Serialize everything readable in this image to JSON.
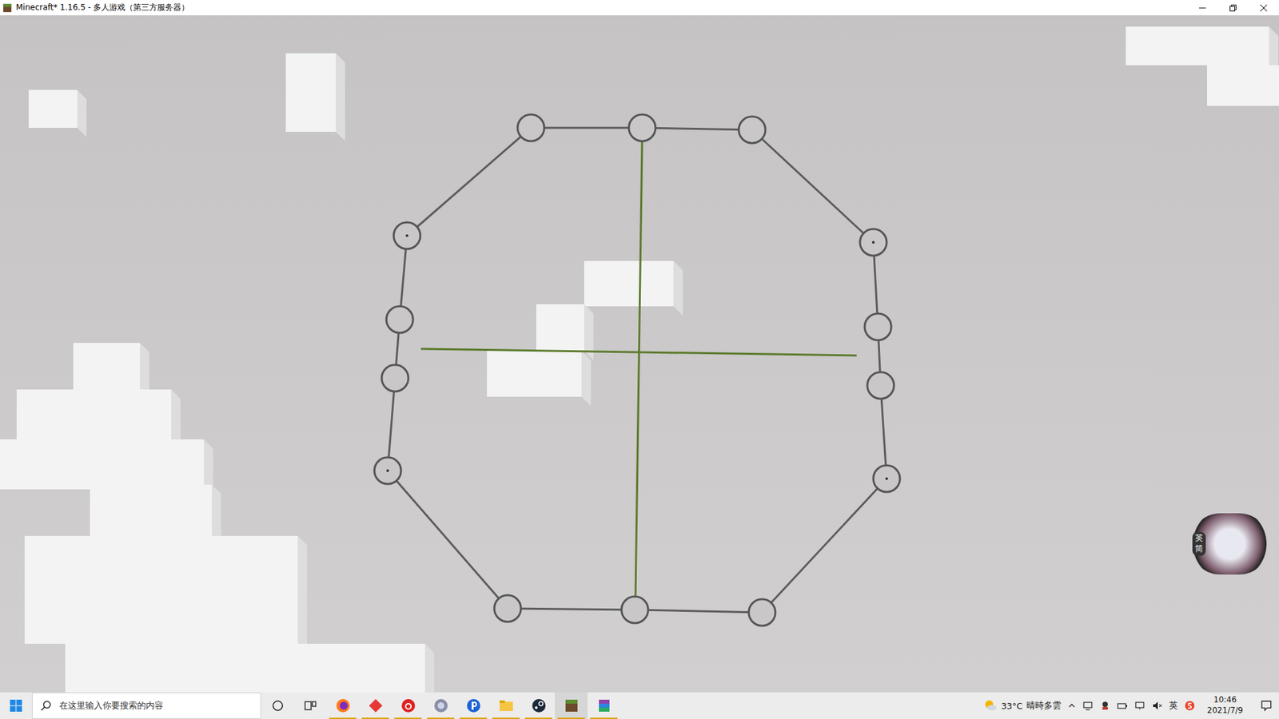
{
  "window": {
    "title": "Minecraft* 1.16.5 - 多人游戏（第三方服务器）"
  },
  "ime_widget": {
    "labels": [
      "英",
      "简"
    ]
  },
  "taskbar": {
    "search": {
      "placeholder": "在这里输入你要搜索的内容"
    },
    "apps": [
      {
        "running": true,
        "selected": false
      },
      {
        "running": true,
        "selected": false
      },
      {
        "running": true,
        "selected": false
      },
      {
        "running": true,
        "selected": false
      },
      {
        "running": true,
        "selected": false
      },
      {
        "running": true,
        "selected": false
      },
      {
        "running": true,
        "selected": false
      },
      {
        "running": true,
        "selected": true
      },
      {
        "running": true,
        "selected": false
      }
    ],
    "tray": {
      "temperature": "33°C",
      "weather": "晴時多雲",
      "input_method": "英",
      "time": "10:46",
      "date": "2021/7/9"
    }
  }
}
